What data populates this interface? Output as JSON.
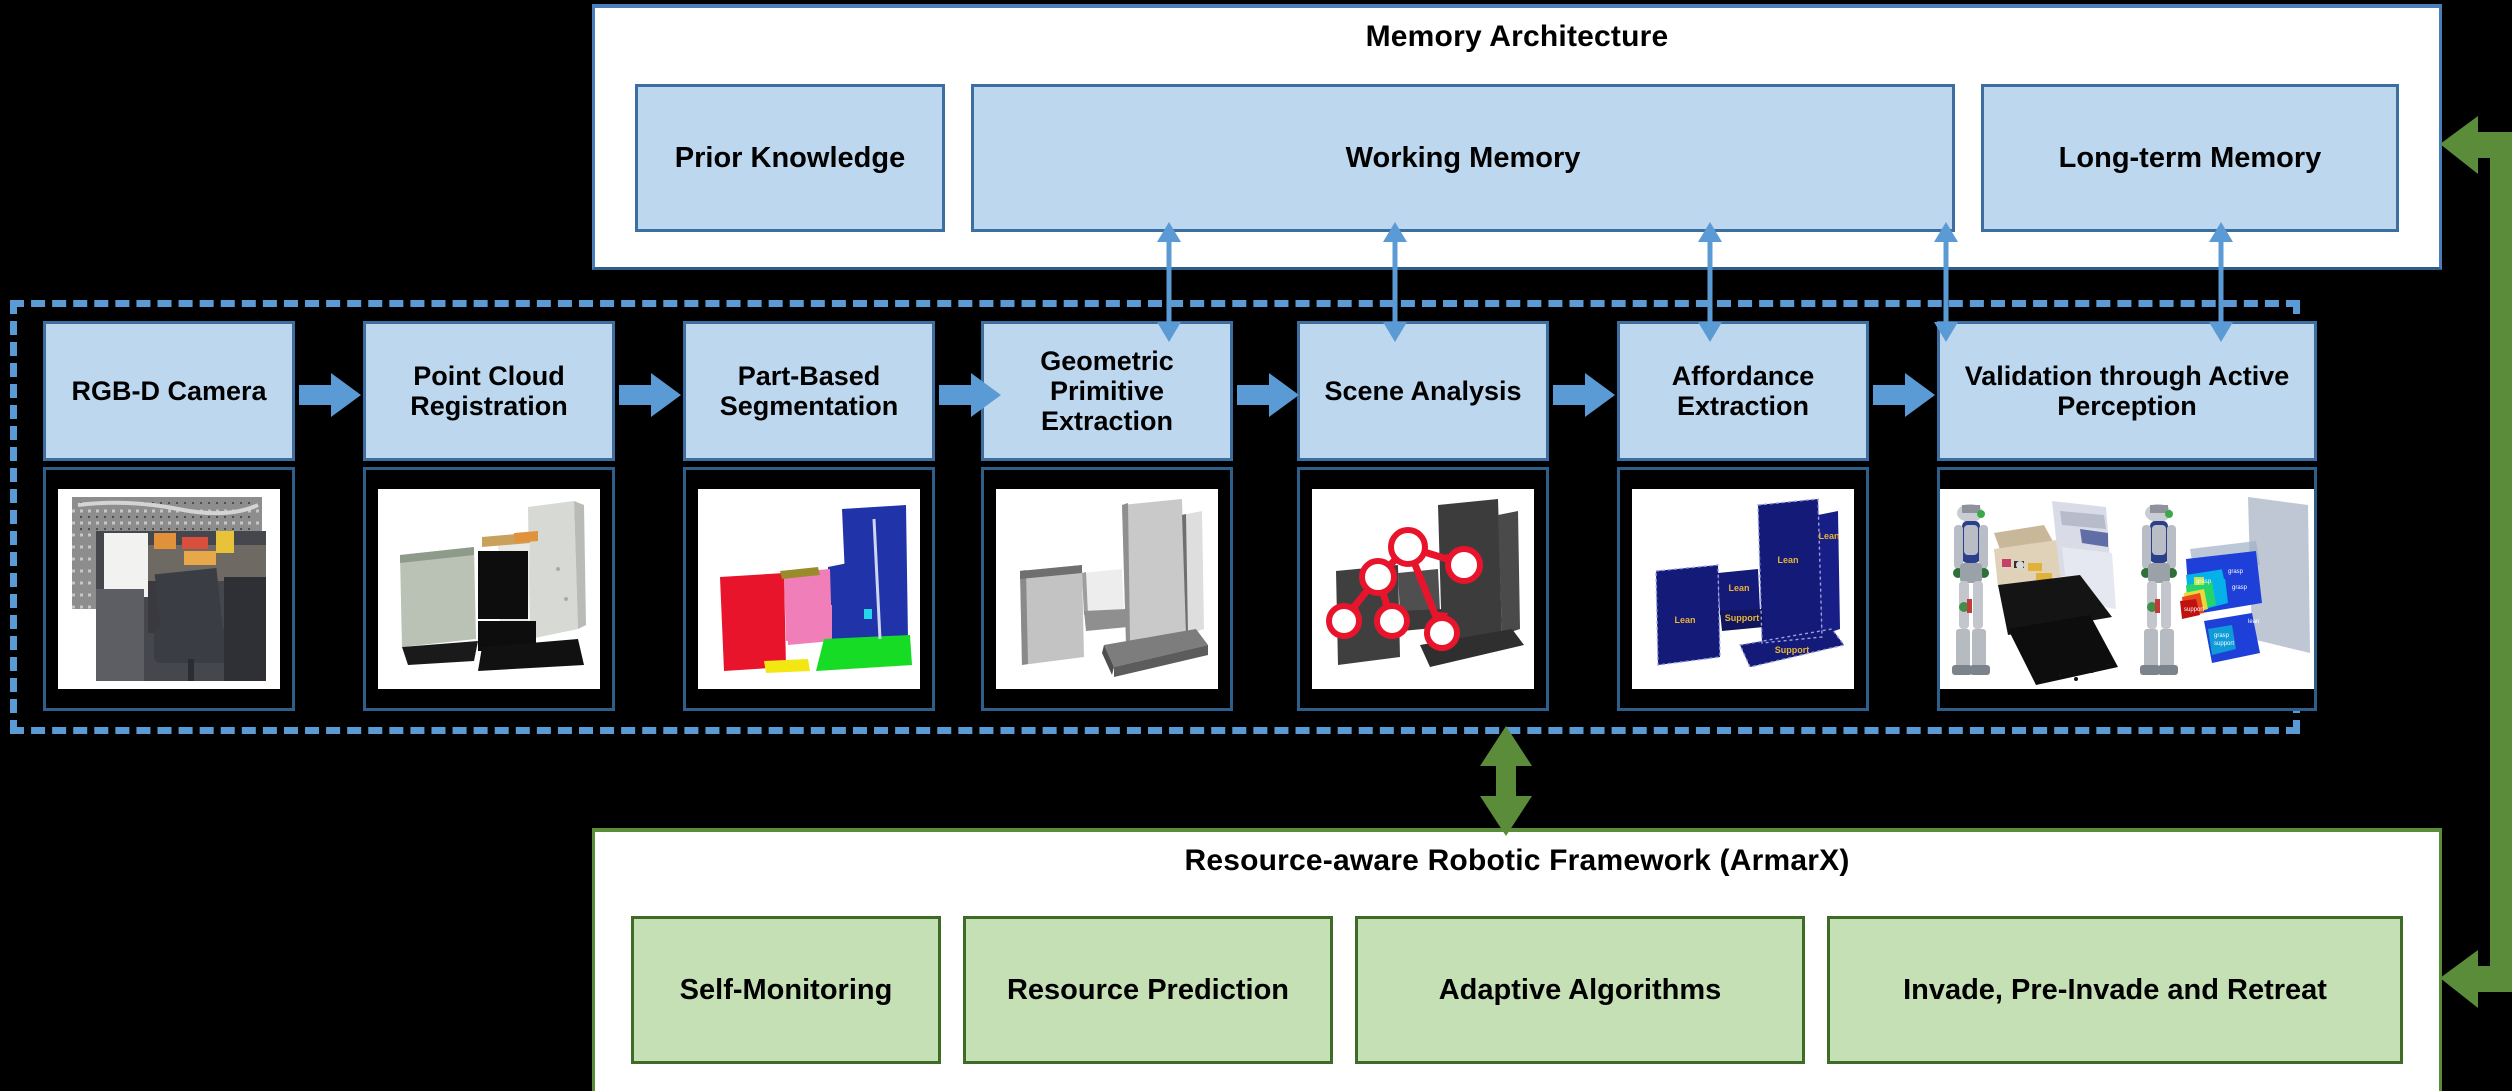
{
  "memory": {
    "title": "Memory Architecture",
    "boxes": [
      {
        "label": "Prior Knowledge"
      },
      {
        "label": "Working Memory"
      },
      {
        "label": "Long-term Memory"
      }
    ]
  },
  "pipeline": {
    "stages": [
      {
        "label": "RGB-D Camera",
        "thumb": "rgbd-depth-and-color-office-scene"
      },
      {
        "label": "Point Cloud Registration",
        "thumb": "registered-point-cloud-room"
      },
      {
        "label": "Part-Based Segmentation",
        "thumb": "color-coded-segmented-parts"
      },
      {
        "label": "Geometric Primitive Extraction",
        "thumb": "grey-planar-primitives"
      },
      {
        "label": "Scene Analysis",
        "thumb": "scene-graph-red-nodes-on-dark-primitives"
      },
      {
        "label": "Affordance Extraction",
        "thumb": "blue-primitives-with-lean-support-labels"
      },
      {
        "label": "Validation through Active Perception",
        "thumb": "humanoid-robot-pointcloud-and-affordance-heatmap"
      }
    ],
    "affordance_labels": [
      "Lean",
      "Lean",
      "Lean",
      "Support",
      "Support"
    ],
    "validation_labels": [
      "grasp",
      "grasp",
      "grasp",
      "support",
      "lean",
      "grasp",
      "support"
    ]
  },
  "framework": {
    "title": "Resource-aware Robotic Framework (ArmarX)",
    "boxes": [
      {
        "label": "Self-Monitoring"
      },
      {
        "label": "Resource Prediction"
      },
      {
        "label": "Adaptive Algorithms"
      },
      {
        "label": "Invade, Pre-Invade and Retreat"
      }
    ]
  },
  "colors": {
    "blue_fill": "#BDD7EE",
    "blue_border": "#3C6E9F",
    "blue_arrow": "#5B9BD5",
    "green_fill": "#C5E0B4",
    "green_border": "#3F6B27",
    "green_arrow": "#5B8C3A",
    "background": "#000000",
    "panel": "#FFFFFF"
  }
}
